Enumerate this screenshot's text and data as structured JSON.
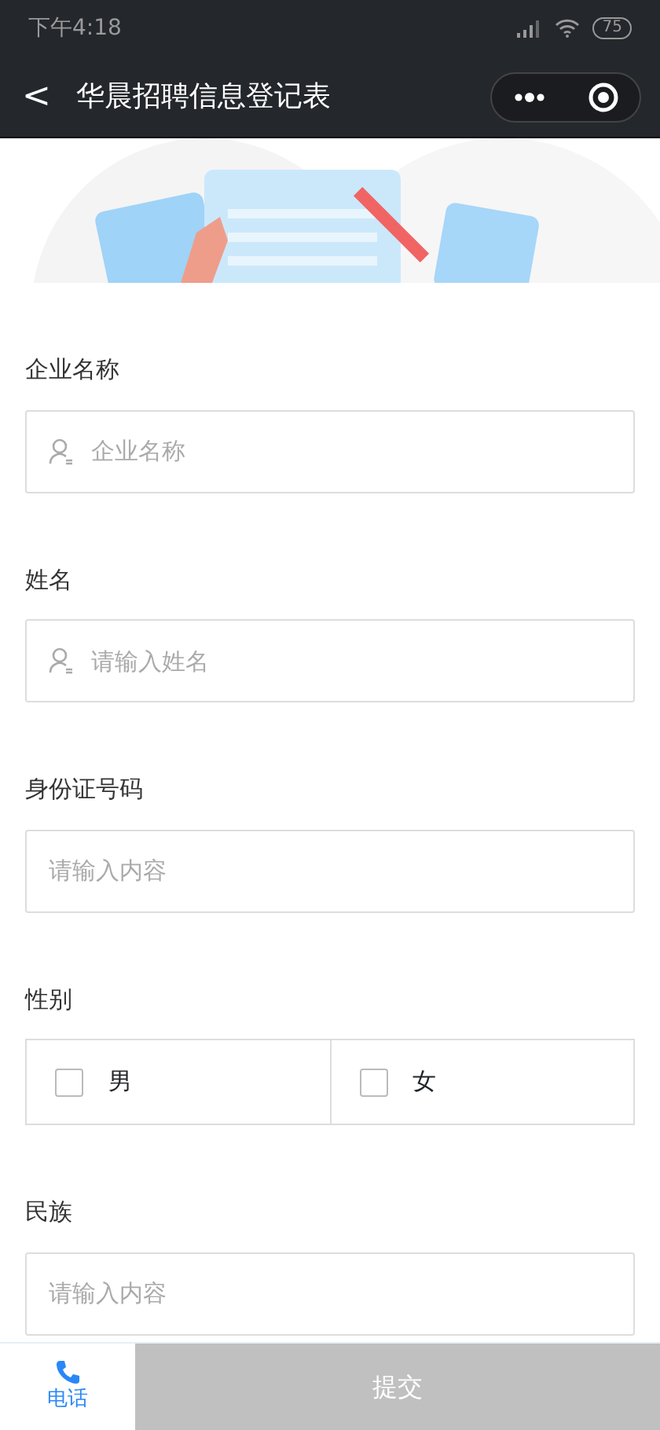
{
  "status_bar": {
    "time": "下午4:18",
    "battery": "75"
  },
  "nav": {
    "back": "<",
    "title": "华晨招聘信息登记表"
  },
  "fields": [
    {
      "kind": "text",
      "label": "企业名称",
      "placeholder": "企业名称",
      "person_icon": true
    },
    {
      "kind": "text",
      "label": "姓名",
      "placeholder": "请输入姓名",
      "person_icon": true
    },
    {
      "kind": "text",
      "label": "身份证号码",
      "placeholder": "请输入内容",
      "person_icon": false
    },
    {
      "kind": "choice",
      "label": "性别",
      "options": [
        {
          "label": "男",
          "checked": false
        },
        {
          "label": "女",
          "checked": false
        }
      ]
    },
    {
      "kind": "text",
      "label": "民族",
      "placeholder": "请输入内容",
      "person_icon": false
    }
  ],
  "bottom_bar": {
    "phone": "电话",
    "submit": "提交",
    "submit_disabled": true
  }
}
